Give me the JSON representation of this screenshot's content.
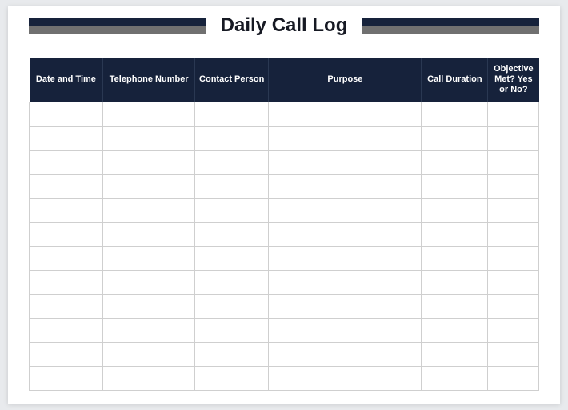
{
  "title": "Daily Call Log",
  "columns": [
    "Date and Time",
    "Telephone Number",
    "Contact Person",
    "Purpose",
    "Call Duration",
    "Objective Met? Yes or No?"
  ],
  "rows": [
    [
      "",
      "",
      "",
      "",
      "",
      ""
    ],
    [
      "",
      "",
      "",
      "",
      "",
      ""
    ],
    [
      "",
      "",
      "",
      "",
      "",
      ""
    ],
    [
      "",
      "",
      "",
      "",
      "",
      ""
    ],
    [
      "",
      "",
      "",
      "",
      "",
      ""
    ],
    [
      "",
      "",
      "",
      "",
      "",
      ""
    ],
    [
      "",
      "",
      "",
      "",
      "",
      ""
    ],
    [
      "",
      "",
      "",
      "",
      "",
      ""
    ],
    [
      "",
      "",
      "",
      "",
      "",
      ""
    ],
    [
      "",
      "",
      "",
      "",
      "",
      ""
    ],
    [
      "",
      "",
      "",
      "",
      "",
      ""
    ],
    [
      "",
      "",
      "",
      "",
      "",
      ""
    ]
  ]
}
